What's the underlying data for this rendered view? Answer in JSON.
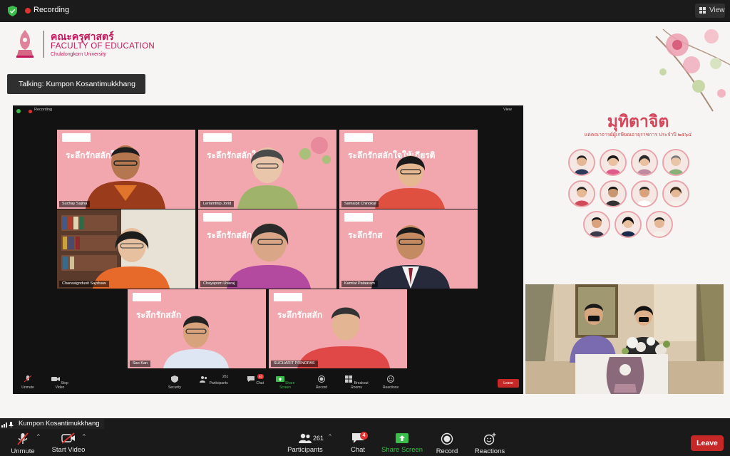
{
  "topbar": {
    "recording_label": "Recording",
    "view_label": "View",
    "shield_color": "#3bbd4b",
    "recording_color": "#e0322e"
  },
  "logo": {
    "thai": "คณะครุศาสตร์",
    "english": "FACULTY OF EDUCATION",
    "university": "Chulalongkorn University",
    "brand_color": "#c2185b"
  },
  "talking": {
    "label": "Talking: Kumpon Kosantimukkhang"
  },
  "inner_meeting": {
    "recording_label": "Recording",
    "view_label": "View",
    "tiles": [
      {
        "name": "Suchay Sajina",
        "slide_title": "ระลึกรักสลักใ ...",
        "kind": "slide-man-orange"
      },
      {
        "name": "Lerlamthip Jorid",
        "slide_title": "ระลึกรักสลักใ",
        "kind": "slide-woman-green"
      },
      {
        "name": "Samaipit Chinokal",
        "slide_title": "ระลึกรักสลักใจให้เกียรติ",
        "kind": "slide-woman-red"
      },
      {
        "name": "Chanasigndusit Saydsaw",
        "slide_title": "",
        "kind": "bookshelf-woman"
      },
      {
        "name": "Chayaporn Uvaraj",
        "slide_title": "ระลึกรักสลัก",
        "kind": "slide-woman-purple"
      },
      {
        "name": "Kamtat Pataaram",
        "slide_title": "ระลึกรักส",
        "kind": "slide-man-suit"
      },
      {
        "name": "Sao Kan",
        "slide_title": "ระลึกรักสลัก",
        "kind": "slide-man-glasses"
      },
      {
        "name": "SUCHARIT PRINOPAS",
        "slide_title": "ระลึกรักสลัก",
        "kind": "slide-woman-elder"
      }
    ],
    "toolbar": {
      "unmute": "Unmute",
      "stop_video": "Stop Video",
      "security": "Security",
      "participants": "Participants",
      "participants_count": "261",
      "chat": "Chat",
      "chat_badge": "40",
      "share_screen": "Share Screen",
      "record": "Record",
      "breakout": "Breakout Rooms",
      "reactions": "Reactions",
      "leave": "Leave"
    }
  },
  "right_panel": {
    "title": "มุทิตาจิต",
    "subtitle": "แด่คณาจารย์ผู้เกษียณอายุราชการ ประจำปี ๒๕๖๔",
    "accent_color": "#d6455a",
    "avatars": [
      {
        "label": "retiree-1"
      },
      {
        "label": "retiree-2"
      },
      {
        "label": "retiree-3"
      },
      {
        "label": "retiree-4"
      },
      {
        "label": "retiree-5"
      },
      {
        "label": "retiree-6"
      },
      {
        "label": "retiree-7"
      },
      {
        "label": "retiree-8"
      },
      {
        "label": "retiree-9"
      },
      {
        "label": "retiree-10"
      },
      {
        "label": "retiree-11"
      }
    ]
  },
  "self_view": {
    "name": "Kumpon Kosantimukkhang"
  },
  "toolbar": {
    "unmute": "Unmute",
    "start_video": "Start Video",
    "participants": "Participants",
    "participants_count": "261",
    "chat": "Chat",
    "chat_badge": "4",
    "share_screen": "Share Screen",
    "record": "Record",
    "reactions": "Reactions",
    "leave": "Leave",
    "leave_color": "#c62828",
    "share_color": "#3bbd4b"
  }
}
